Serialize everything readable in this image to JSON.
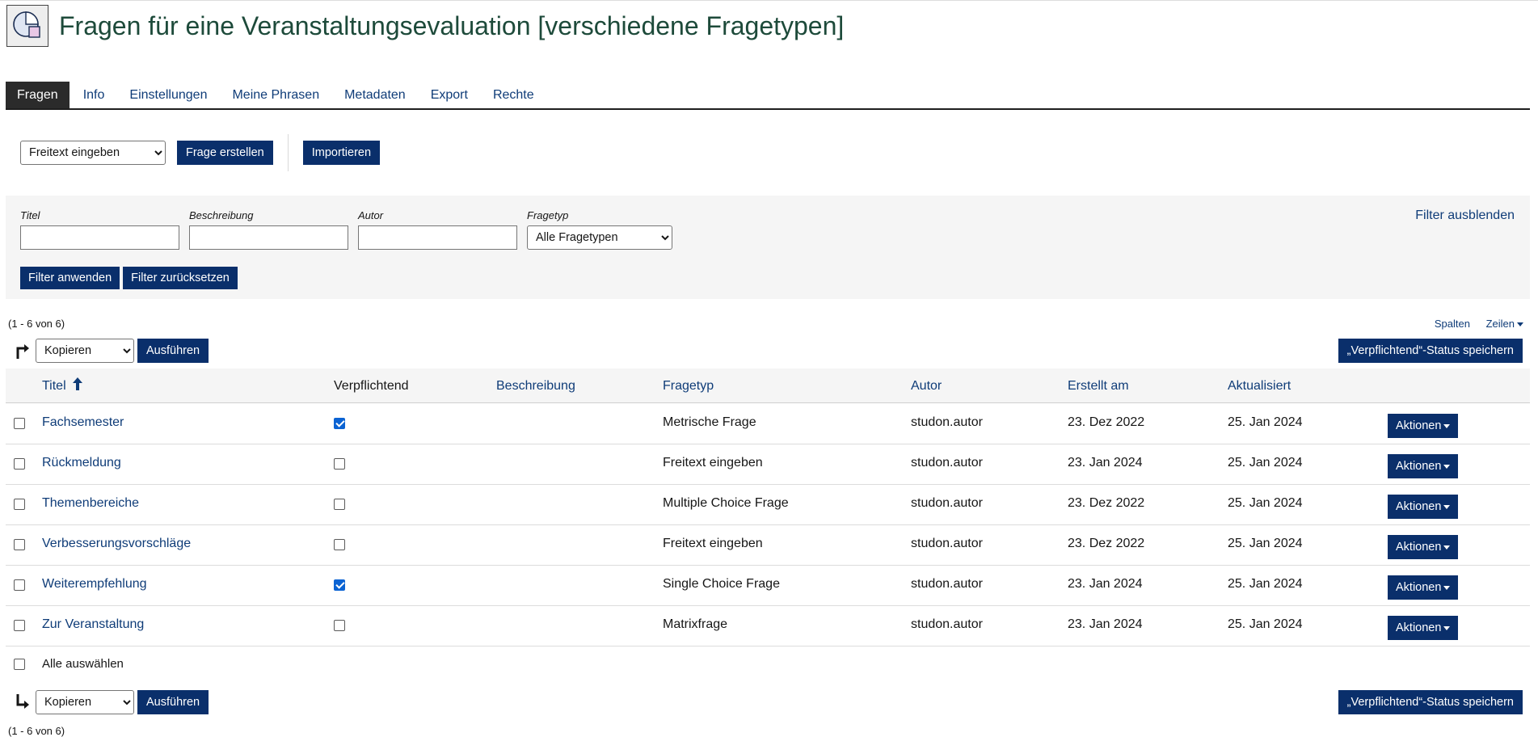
{
  "page": {
    "title": "Fragen für eine Veranstaltungsevaluation [verschiedene Fragetypen]",
    "logo_icon": "survey-pool-icon"
  },
  "tabs": [
    {
      "label": "Fragen",
      "active": true
    },
    {
      "label": "Info",
      "active": false
    },
    {
      "label": "Einstellungen",
      "active": false
    },
    {
      "label": "Meine Phrasen",
      "active": false
    },
    {
      "label": "Metadaten",
      "active": false
    },
    {
      "label": "Export",
      "active": false
    },
    {
      "label": "Rechte",
      "active": false
    }
  ],
  "toolbar": {
    "question_type_selected": "Freitext eingeben",
    "create_label": "Frage erstellen",
    "import_label": "Importieren"
  },
  "filter": {
    "title_label": "Titel",
    "description_label": "Beschreibung",
    "author_label": "Autor",
    "type_label": "Fragetyp",
    "type_selected": "Alle Fragetypen",
    "toggle_label": "Filter ausblenden",
    "apply_label": "Filter anwenden",
    "reset_label": "Filter zurücksetzen"
  },
  "table": {
    "range_text": "(1 - 6 von 6)",
    "columns_link": "Spalten",
    "rows_link": "Zeilen",
    "multi_command_selected": "Kopieren",
    "execute_label": "Ausführen",
    "save_mandatory_label": "„Verpflichtend“-Status speichern",
    "headers": {
      "title": "Titel",
      "mandatory": "Verpflichtend",
      "description": "Beschreibung",
      "type": "Fragetyp",
      "author": "Autor",
      "created": "Erstellt am",
      "updated": "Aktualisiert"
    },
    "sort_icon": "arrow-up-icon",
    "action_label": "Aktionen",
    "rows": [
      {
        "title": "Fachsemester",
        "mandatory": true,
        "type": "Metrische Frage",
        "author": "studon.autor",
        "created": "23. Dez 2022",
        "updated": "25. Jan 2024"
      },
      {
        "title": "Rückmeldung",
        "mandatory": false,
        "type": "Freitext eingeben",
        "author": "studon.autor",
        "created": "23. Jan 2024",
        "updated": "25. Jan 2024"
      },
      {
        "title": "Themenbereiche",
        "mandatory": false,
        "type": "Multiple Choice Frage",
        "author": "studon.autor",
        "created": "23. Dez 2022",
        "updated": "25. Jan 2024"
      },
      {
        "title": "Verbesserungsvorschläge",
        "mandatory": false,
        "type": "Freitext eingeben",
        "author": "studon.autor",
        "created": "23. Dez 2022",
        "updated": "25. Jan 2024"
      },
      {
        "title": "Weiterempfehlung",
        "mandatory": true,
        "type": "Single Choice Frage",
        "author": "studon.autor",
        "created": "23. Jan 2024",
        "updated": "25. Jan 2024"
      },
      {
        "title": "Zur Veranstaltung",
        "mandatory": false,
        "type": "Matrixfrage",
        "author": "studon.autor",
        "created": "23. Jan 2024",
        "updated": "25. Jan 2024"
      }
    ],
    "select_all_label": "Alle auswählen"
  }
}
